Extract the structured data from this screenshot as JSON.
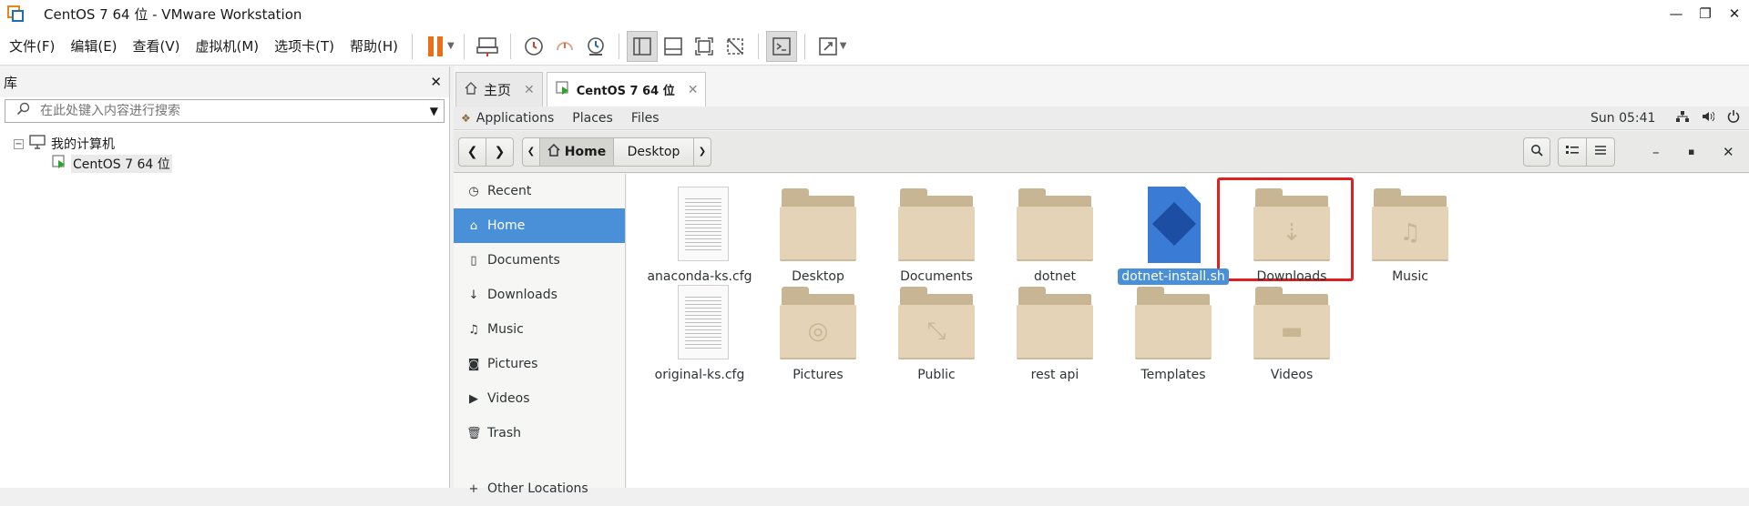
{
  "window": {
    "title": "CentOS 7 64 位 - VMware Workstation",
    "min": "—",
    "restore": "❐",
    "close": "✕"
  },
  "menu": [
    "文件(F)",
    "编辑(E)",
    "查看(V)",
    "虚拟机(M)",
    "选项卡(T)",
    "帮助(H)"
  ],
  "library": {
    "title": "库",
    "close": "✕",
    "search_placeholder": "在此处键入内容进行搜索",
    "tree_root": "我的计算机",
    "tree_vm": "CentOS 7 64 位",
    "toggle": "−"
  },
  "tabs": [
    {
      "label": "主页"
    },
    {
      "label": "CentOS 7 64 位"
    }
  ],
  "tab_close": "✕",
  "gnome": {
    "applications": "Applications",
    "places": "Places",
    "files": "Files",
    "clock": "Sun 05:41"
  },
  "pathbar": {
    "home": "Home",
    "desktop": "Desktop"
  },
  "sidebar": [
    "Recent",
    "Home",
    "Documents",
    "Downloads",
    "Music",
    "Pictures",
    "Videos",
    "Trash"
  ],
  "sidebar_other": "Other Locations",
  "files": [
    {
      "name": "anaconda-ks.cfg",
      "kind": "doc"
    },
    {
      "name": "Desktop",
      "kind": "folder",
      "emb": ""
    },
    {
      "name": "Documents",
      "kind": "folder",
      "emb": ""
    },
    {
      "name": "dotnet",
      "kind": "folder",
      "emb": ""
    },
    {
      "name": "dotnet-install.sh",
      "kind": "script"
    },
    {
      "name": "Downloads",
      "kind": "folder",
      "emb": "⇣"
    },
    {
      "name": "Music",
      "kind": "folder",
      "emb": "♫"
    },
    {
      "name": "original-ks.cfg",
      "kind": "doc"
    },
    {
      "name": "Pictures",
      "kind": "folder",
      "emb": "◎"
    },
    {
      "name": "Public",
      "kind": "folder",
      "emb": "⤡"
    },
    {
      "name": "rest api",
      "kind": "folder",
      "emb": ""
    },
    {
      "name": "Templates",
      "kind": "folder",
      "emb": ""
    },
    {
      "name": "Videos",
      "kind": "folder",
      "emb": "▬"
    }
  ],
  "selected_file": "dotnet-install.sh"
}
